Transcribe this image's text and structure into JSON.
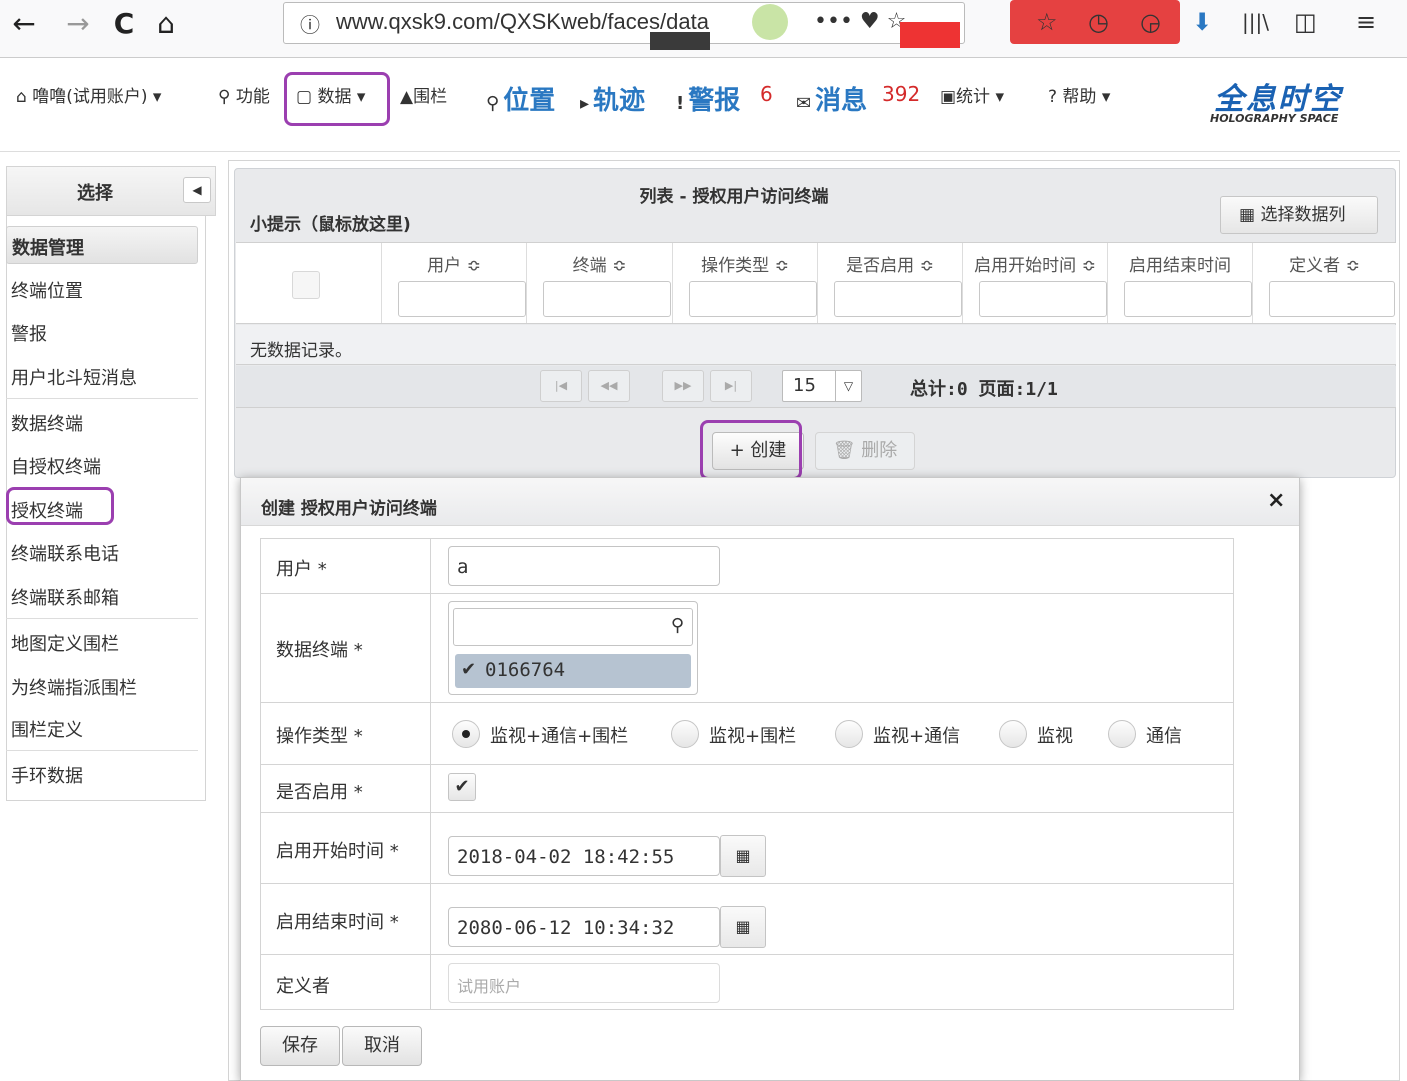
{
  "browser": {
    "back": "←",
    "forward": "→",
    "reload": "C",
    "home": "⌂",
    "url_info": "ⓘ",
    "url": "www.qxsk9.com/QXSKweb/faces/data",
    "url_suffix": "••• ♥ ☆",
    "toolbar_icons": [
      "⬇",
      "|||\\",
      "◫",
      "≡"
    ]
  },
  "header": {
    "user_menu": "⌂ 噜噜(试用账户) ▾",
    "function_menu": "⚲ 功能",
    "data_menu": "▢ 数据 ▾",
    "fence_menu": "▲围栏",
    "position_menu": "位置",
    "track_menu": "轨迹",
    "alarm_menu": "警报",
    "alarm_count": "6",
    "message_menu": "消息",
    "message_count": "392",
    "stats_menu": "▣统计 ▾",
    "help_menu": "? 帮助 ▾",
    "logo_cn": "全息时空",
    "logo_en": "HOLOGRAPHY SPACE"
  },
  "sidebar": {
    "title": "选择",
    "category": "数据管理",
    "items": [
      "终端位置",
      "警报",
      "用户北斗短消息",
      "数据终端",
      "自授权终端",
      "授权终端",
      "终端联系电话",
      "终端联系邮箱",
      "地图定义围栏",
      "为终端指派围栏",
      "围栏定义",
      "手环数据"
    ]
  },
  "list": {
    "title": "列表 - 授权用户访问终端",
    "hint": "小提示（鼠标放这里)",
    "column_select": "选择数据列",
    "columns": [
      "用户 ≎",
      "终端 ≎",
      "操作类型 ≎",
      "是否启用 ≎",
      "启用开始时间 ≎",
      "启用结束时间",
      "定义者 ≎"
    ],
    "empty_message": "无数据记录。",
    "rows_per_page": "15",
    "total": "总计:0 页面:1/1",
    "create_button": "+ 创建",
    "delete_button": "删除"
  },
  "dialog": {
    "title": "创建 授权用户访问终端",
    "close": "×",
    "fields": {
      "user_label": "用户 *",
      "user_value": "a",
      "terminal_label": "数据终端 *",
      "terminal_selected": "0166764",
      "op_label": "操作类型 *",
      "op_options": [
        "监视+通信+围栏",
        "监视+围栏",
        "监视+通信",
        "监视",
        "通信"
      ],
      "op_selected_index": 0,
      "enabled_label": "是否启用 *",
      "enabled_value": true,
      "start_label": "启用开始时间 *",
      "start_value": "2018-04-02 18:42:55",
      "end_label": "启用结束时间 *",
      "end_value": "2080-06-12 10:34:32",
      "definer_label": "定义者",
      "definer_placeholder": "试用账户"
    },
    "save_button": "保存",
    "cancel_button": "取消"
  },
  "colors": {
    "highlight": "#9b3fb0",
    "link_blue": "#2a78c2",
    "count_red": "#d42a2a"
  }
}
